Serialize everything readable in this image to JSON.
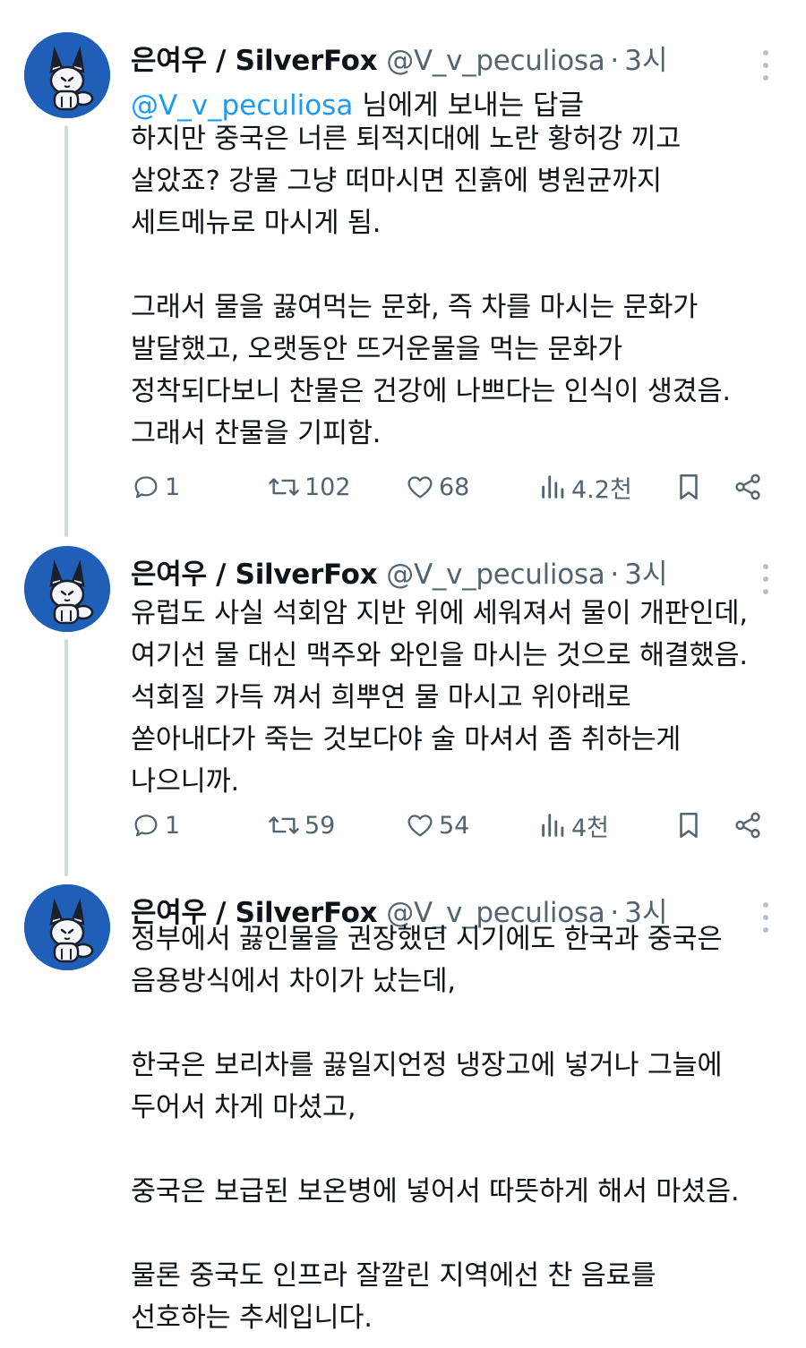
{
  "colors": {
    "text": "#0f1419",
    "muted": "#536471",
    "link": "#1d9bf0",
    "avatar_bg": "#1f5fb8",
    "thread_line": "#cfd9de"
  },
  "tweets": [
    {
      "display_name": "은여우 / SilverFox",
      "handle": "@V_v_peculiosa",
      "separator": "·",
      "time": "3시",
      "reply_to": {
        "mention": "@V_v_peculiosa",
        "suffix": " 님에게 보내는 답글"
      },
      "body": "하지만 중국은 너른 퇴적지대에 노란 황허강 끼고\n살았죠? 강물 그냥 떠마시면 진흙에 병원균까지\n세트메뉴로 마시게 됨.\n\n그래서 물을 끓여먹는 문화, 즉 차를 마시는 문화가\n발달했고, 오랫동안 뜨거운물을 먹는 문화가\n정착되다보니 찬물은 건강에 나쁘다는 인식이 생겼음.\n그래서 찬물을 기피함.",
      "stats": {
        "replies": "1",
        "retweets": "102",
        "likes": "68",
        "views": "4.2천"
      }
    },
    {
      "display_name": "은여우 / SilverFox",
      "handle": "@V_v_peculiosa",
      "separator": "·",
      "time": "3시",
      "body": "유럽도 사실 석회암 지반 위에 세워져서 물이 개판인데,\n여기선 물 대신 맥주와 와인을 마시는 것으로 해결했음.\n석회질 가득 껴서 희뿌연 물 마시고 위아래로\n쏟아내다가 죽는 것보다야 술 마셔서 좀 취하는게\n나으니까.",
      "stats": {
        "replies": "1",
        "retweets": "59",
        "likes": "54",
        "views": "4천"
      }
    },
    {
      "display_name": "은여우 / SilverFox",
      "handle": "@V_v_peculiosa",
      "separator": "·",
      "time": "3시",
      "body": "정부에서 끓인물을 권장했던 시기에도 한국과 중국은\n음용방식에서 차이가 났는데,\n\n한국은 보리차를 끓일지언정 냉장고에 넣거나 그늘에\n두어서 차게 마셨고,\n\n중국은 보급된 보온병에 넣어서 따뜻하게 해서 마셨음.\n\n물론 중국도 인프라 잘깔린 지역에선 찬 음료를\n선호하는 추세입니다."
    }
  ],
  "icons": [
    "reply-icon",
    "retweet-icon",
    "like-icon",
    "views-icon",
    "bookmark-icon",
    "share-icon",
    "more-icon",
    "avatar-fox"
  ]
}
